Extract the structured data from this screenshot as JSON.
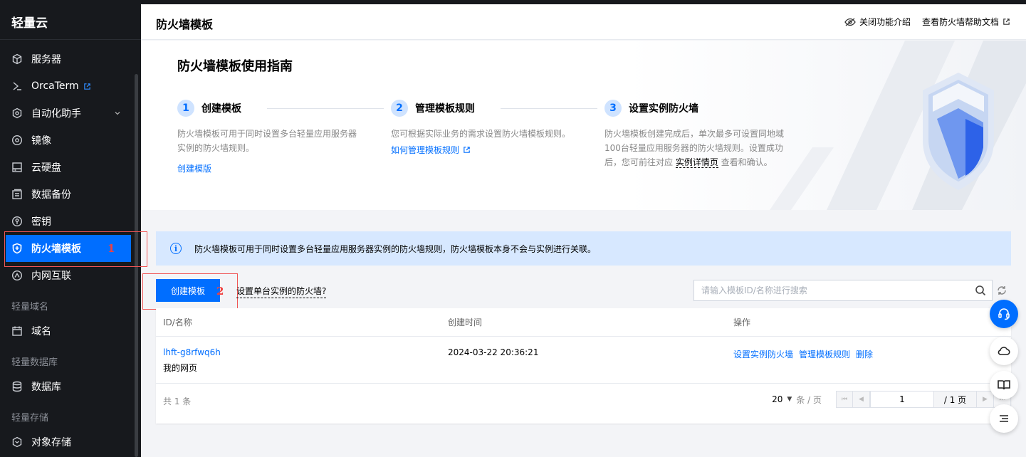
{
  "sidebar": {
    "brand": "轻量云",
    "items": [
      {
        "label": "服务器",
        "icon": "cube-icon"
      },
      {
        "label": "OrcaTerm",
        "icon": "terminal-icon",
        "external": true
      },
      {
        "label": "自动化助手",
        "icon": "automation-icon",
        "expandable": true
      },
      {
        "label": "镜像",
        "icon": "disc-icon"
      },
      {
        "label": "云硬盘",
        "icon": "disk-icon"
      },
      {
        "label": "数据备份",
        "icon": "backup-icon"
      },
      {
        "label": "密钥",
        "icon": "key-icon"
      },
      {
        "label": "防火墙模板",
        "icon": "shield-icon",
        "active": true
      },
      {
        "label": "内网互联",
        "icon": "network-icon"
      }
    ],
    "sections": [
      {
        "title": "轻量域名",
        "items": [
          {
            "label": "域名",
            "icon": "domain-icon"
          }
        ]
      },
      {
        "title": "轻量数据库",
        "items": [
          {
            "label": "数据库",
            "icon": "database-icon"
          }
        ]
      },
      {
        "title": "轻量存储",
        "items": [
          {
            "label": "对象存储",
            "icon": "storage-icon"
          }
        ]
      }
    ]
  },
  "annotations": {
    "one": "1",
    "two": "2"
  },
  "header": {
    "title": "防火墙模板",
    "close_intro": "关闭功能介绍",
    "help_doc": "查看防火墙帮助文档"
  },
  "guide": {
    "title": "防火墙模板使用指南",
    "steps": [
      {
        "num": "1",
        "title": "创建模板",
        "desc": "防火墙模板可用于同时设置多台轻量应用服务器实例的防火墙规则。",
        "link": "创建模版"
      },
      {
        "num": "2",
        "title": "管理模板规则",
        "desc": "您可根据实际业务的需求设置防火墙模板规则。",
        "link": "如何管理模板规则"
      },
      {
        "num": "3",
        "title": "设置实例防火墙",
        "desc_part1": "防火墙模板创建完成后，单次最多可设置同地域100台轻量应用服务器的防火墙规则。设置成功后，您可前往对应 ",
        "desc_link": "实例详情页",
        "desc_part2": " 查看和确认。"
      }
    ]
  },
  "notice": "防火墙模板可用于同时设置多台轻量应用服务器实例的防火墙规则，防火墙模板本身不会与实例进行关联。",
  "toolbar": {
    "create_label": "创建模板",
    "single_instance_link": "设置单台实例的防火墙?",
    "search_placeholder": "请输入模板ID/名称进行搜索"
  },
  "table": {
    "columns": [
      "ID/名称",
      "创建时间",
      "操作"
    ],
    "rows": [
      {
        "id": "lhft-g8rfwq6h",
        "name": "我的网页",
        "created": "2024-03-22 20:36:21",
        "actions": [
          "设置实例防火墙",
          "管理模板规则",
          "删除"
        ]
      }
    ],
    "total": "共 1 条",
    "pagination": {
      "page_size": "20",
      "unit": "条 / 页",
      "current": "1",
      "total_pages": "/ 1 页"
    }
  },
  "colors": {
    "accent": "#006eff",
    "sidebar_bg": "#17191d",
    "notice_bg": "#d7e8ff"
  }
}
